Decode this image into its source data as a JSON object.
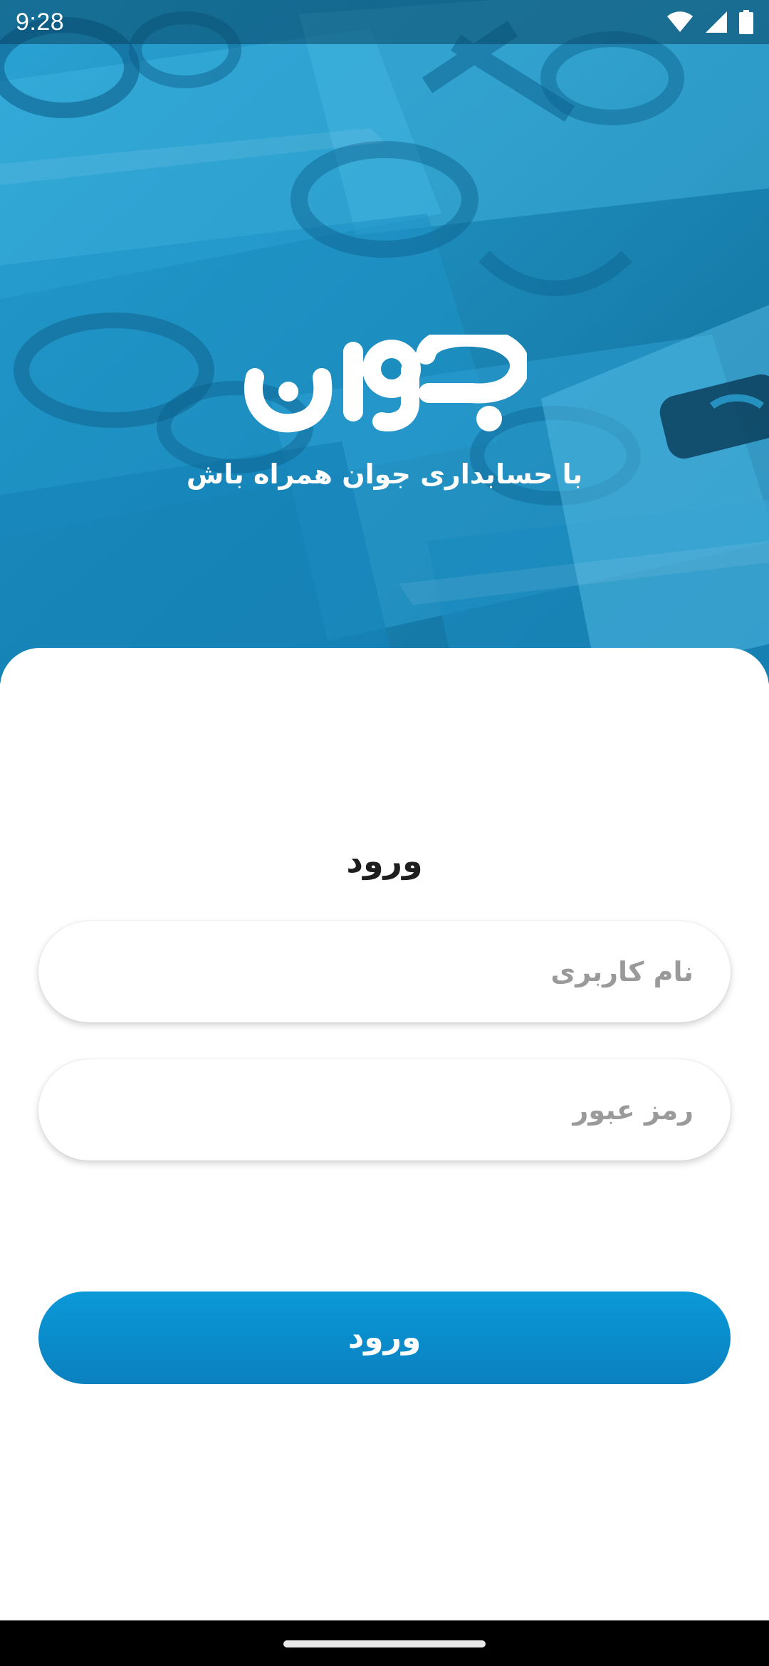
{
  "status_bar": {
    "time": "9:28",
    "icons": [
      "wifi-icon",
      "cellular-signal-icon",
      "battery-icon"
    ]
  },
  "hero": {
    "logo_text": "جوان",
    "tagline": "با حسابداری جوان همراه باش"
  },
  "login": {
    "title": "ورود",
    "username_placeholder": "نام کاربری",
    "username_value": "",
    "password_placeholder": "رمز عبور",
    "password_value": "",
    "submit_label": "ورود"
  },
  "colors": {
    "primary": "#0b8ccd",
    "hero_blue": "#137fb0",
    "placeholder": "#9a9a9a",
    "title": "#1e1e1e"
  }
}
